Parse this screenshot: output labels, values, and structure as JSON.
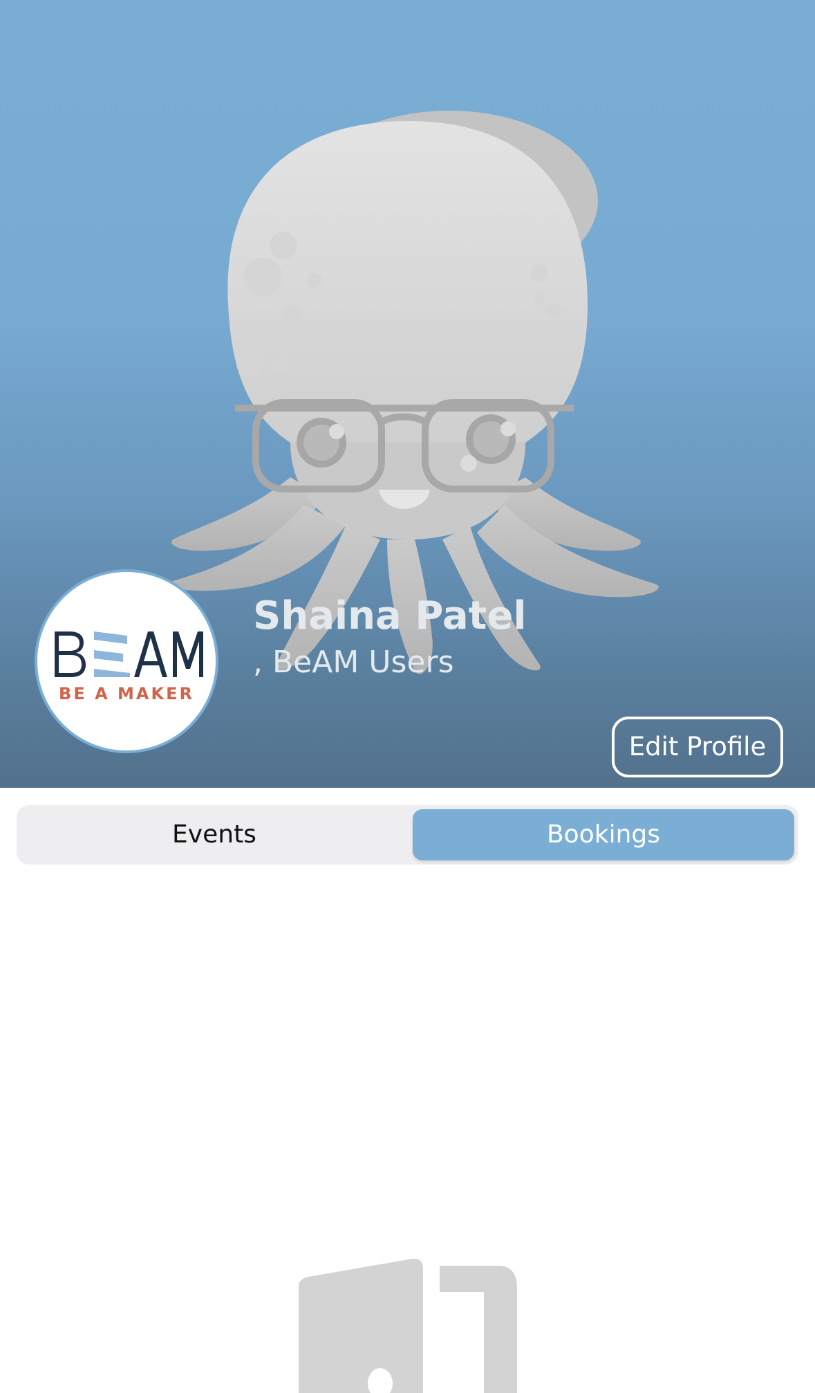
{
  "profile": {
    "name": "Shaina Patel",
    "subtitle": ", BeAM Users",
    "edit_button_label": "Edit Profile",
    "avatar_logo_text": "BEAM",
    "avatar_logo_tagline": "BE A MAKER"
  },
  "tabs": {
    "items": [
      {
        "label": "Events",
        "selected": false
      },
      {
        "label": "Bookings",
        "selected": true
      }
    ]
  },
  "icons": {
    "header_background": "octopus-mascot-illustration",
    "empty_state": "open-door-icon"
  },
  "colors": {
    "accent": "#7aaed4",
    "header_bottom": "#52718c",
    "logo_navy": "#1f3147",
    "logo_orange": "#d2634a",
    "segment_bg": "#eeeef0",
    "empty_icon_gray": "#d3d3d3"
  }
}
